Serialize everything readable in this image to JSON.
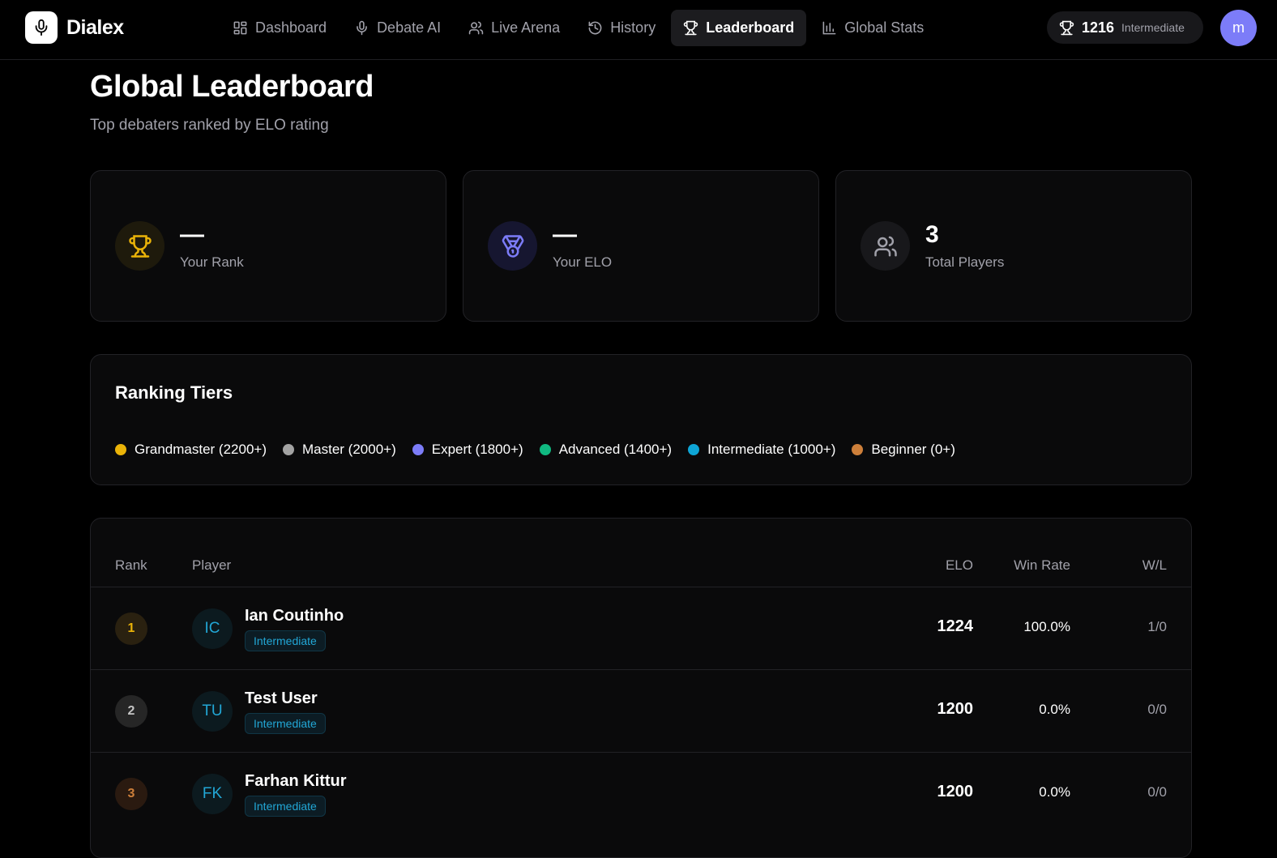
{
  "brand": {
    "name": "Dialex"
  },
  "nav": {
    "items": [
      {
        "label": "Dashboard",
        "icon": "dashboard-icon"
      },
      {
        "label": "Debate AI",
        "icon": "mic-icon"
      },
      {
        "label": "Live Arena",
        "icon": "users-icon"
      },
      {
        "label": "History",
        "icon": "history-icon"
      },
      {
        "label": "Leaderboard",
        "icon": "trophy-icon",
        "active": true
      },
      {
        "label": "Global Stats",
        "icon": "bar-chart-icon"
      }
    ]
  },
  "user": {
    "elo": "1216",
    "tier": "Intermediate",
    "avatar_initial": "m"
  },
  "page": {
    "title": "Global Leaderboard",
    "subtitle": "Top debaters ranked by ELO rating"
  },
  "stats": {
    "your_rank": {
      "value": "—",
      "label": "Your Rank"
    },
    "your_elo": {
      "value": "—",
      "label": "Your ELO"
    },
    "total_players": {
      "value": "3",
      "label": "Total Players"
    }
  },
  "tiers": {
    "title": "Ranking Tiers",
    "items": [
      {
        "label": "Grandmaster (2200+)",
        "color": "#eab308"
      },
      {
        "label": "Master (2000+)",
        "color": "#a3a3a3"
      },
      {
        "label": "Expert (1800+)",
        "color": "#7c7cf8"
      },
      {
        "label": "Advanced (1400+)",
        "color": "#10b981"
      },
      {
        "label": "Intermediate (1000+)",
        "color": "#0ea5d6"
      },
      {
        "label": "Beginner (0+)",
        "color": "#cd7f3a"
      }
    ]
  },
  "table": {
    "headers": {
      "rank": "Rank",
      "player": "Player",
      "elo": "ELO",
      "win_rate": "Win Rate",
      "wl": "W/L"
    },
    "rows": [
      {
        "rank": "1",
        "initials": "IC",
        "name": "Ian Coutinho",
        "tier": "Intermediate",
        "elo": "1224",
        "win_rate": "100.0%",
        "wl": "1/0"
      },
      {
        "rank": "2",
        "initials": "TU",
        "name": "Test User",
        "tier": "Intermediate",
        "elo": "1200",
        "win_rate": "0.0%",
        "wl": "0/0"
      },
      {
        "rank": "3",
        "initials": "FK",
        "name": "Farhan Kittur",
        "tier": "Intermediate",
        "elo": "1200",
        "win_rate": "0.0%",
        "wl": "0/0"
      }
    ]
  }
}
